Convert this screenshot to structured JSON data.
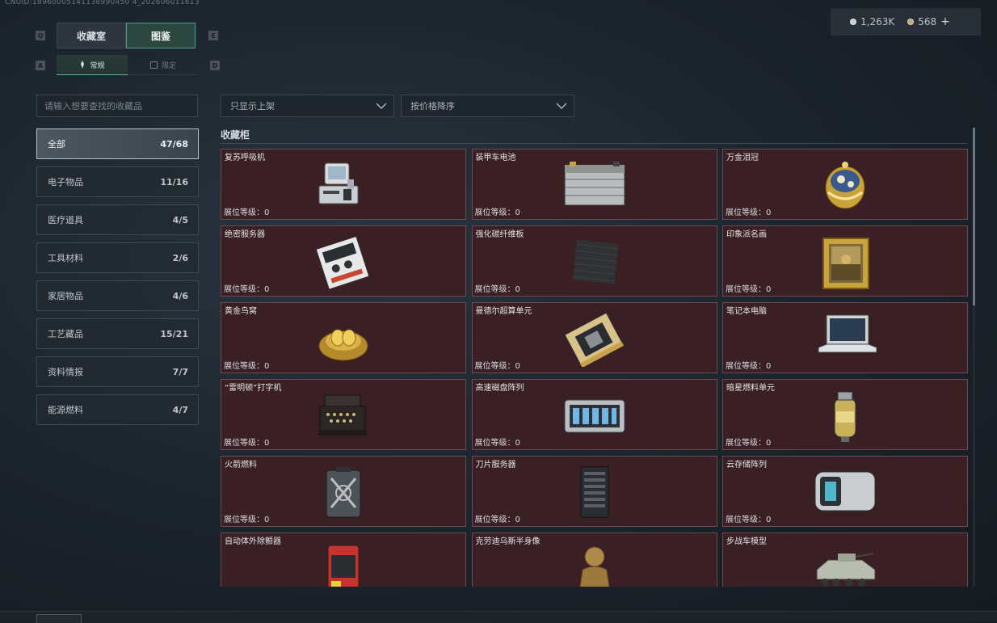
{
  "cnuid": "CNUID:18960005141138990450 4_202606011613",
  "currency": {
    "silver_amount": "1,263K",
    "gold_amount": "568",
    "add_label": "+"
  },
  "keyhints": {
    "tab_prev": "Q",
    "tab_next": "E",
    "sub_prev": "A",
    "sub_next": "D"
  },
  "tabs": [
    {
      "label": "收藏室"
    },
    {
      "label": "图鉴",
      "active": true
    }
  ],
  "subtabs": [
    {
      "label": "常规",
      "active": true
    },
    {
      "label": "限定"
    }
  ],
  "search": {
    "placeholder": "请输入想要查找的收藏品"
  },
  "filters": {
    "listing": "只显示上架",
    "sort": "按价格降序"
  },
  "categories": [
    {
      "label": "全部",
      "count": "47/68",
      "active": true
    },
    {
      "label": "电子物品",
      "count": "11/16"
    },
    {
      "label": "医疗道具",
      "count": "4/5"
    },
    {
      "label": "工具材料",
      "count": "2/6"
    },
    {
      "label": "家居物品",
      "count": "4/6"
    },
    {
      "label": "工艺藏品",
      "count": "15/21"
    },
    {
      "label": "资料情报",
      "count": "7/7"
    },
    {
      "label": "能源燃料",
      "count": "4/7"
    }
  ],
  "section_title": "收藏柜",
  "level_label": "展位等级：",
  "items": [
    {
      "name": "复苏呼吸机",
      "level": "0",
      "icon": "respirator-icon"
    },
    {
      "name": "装甲车电池",
      "level": "0",
      "icon": "battery-icon"
    },
    {
      "name": "万金泪冠",
      "level": "0",
      "icon": "jeweled-crown-icon"
    },
    {
      "name": "绝密服务器",
      "level": "0",
      "icon": "server-board-icon"
    },
    {
      "name": "强化碳纤维板",
      "level": "0",
      "icon": "carbon-plate-icon"
    },
    {
      "name": "印象派名画",
      "level": "0",
      "icon": "painting-icon"
    },
    {
      "name": "黄金鸟窝",
      "level": "0",
      "icon": "golden-nest-icon"
    },
    {
      "name": "曼德尔超算单元",
      "level": "0",
      "icon": "supercomputer-unit-icon"
    },
    {
      "name": "笔记本电脑",
      "level": "0",
      "icon": "laptop-icon"
    },
    {
      "name": "“雷明顿”打字机",
      "level": "0",
      "icon": "typewriter-icon"
    },
    {
      "name": "高速磁盘阵列",
      "level": "0",
      "icon": "disk-array-icon"
    },
    {
      "name": "暗星燃料单元",
      "level": "0",
      "icon": "fuel-cell-icon"
    },
    {
      "name": "火箭燃料",
      "level": "0",
      "icon": "fuel-canister-icon"
    },
    {
      "name": "刀片服务器",
      "level": "0",
      "icon": "blade-server-icon"
    },
    {
      "name": "云存储阵列",
      "level": "0",
      "icon": "cloud-storage-icon"
    },
    {
      "name": "自动体外除颤器",
      "level": "",
      "icon": "defibrillator-icon"
    },
    {
      "name": "克劳迪乌斯半身像",
      "level": "",
      "icon": "bust-icon"
    },
    {
      "name": "步战车模型",
      "level": "",
      "icon": "ifv-model-icon"
    }
  ]
}
